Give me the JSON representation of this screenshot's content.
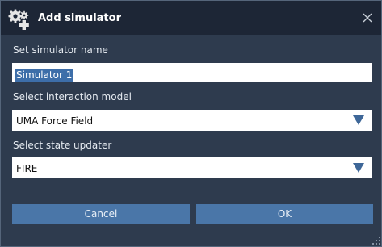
{
  "window": {
    "title": "Add simulator",
    "title_icon": "gears-plus-icon",
    "close_icon": "close-icon"
  },
  "form": {
    "name_label": "Set simulator name",
    "name_value": "Simulator 1",
    "model_label": "Select interaction model",
    "model_value": "UMA Force Field",
    "updater_label": "Select state updater",
    "updater_value": "FIRE"
  },
  "buttons": {
    "cancel": "Cancel",
    "ok": "OK"
  },
  "colors": {
    "background": "#2e3b4e",
    "titlebar": "#1d2636",
    "button": "#4a76a8",
    "dropdown_arrow": "#3e6798",
    "selection": "#3d6ea9"
  }
}
